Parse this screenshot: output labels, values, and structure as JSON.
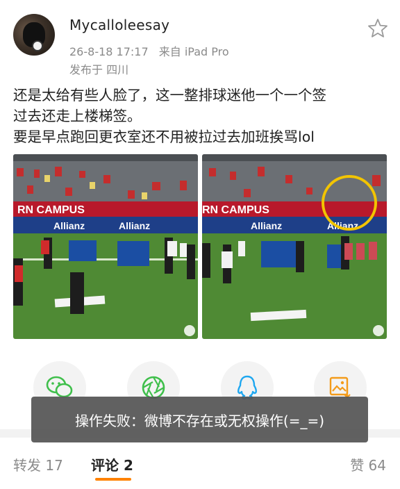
{
  "post": {
    "username": "Mycalloleesay",
    "timestamp": "26-8-18 17:17",
    "source": "来自 iPad Pro",
    "location": "发布于 四川",
    "text_line1": "还是太给有些人脸了，这一整排球迷他一个一个签",
    "text_line2": "过去还走上楼梯签。",
    "text_line3": "要是早点跑回更衣室还不用被拉过去加班挨骂lol"
  },
  "media": [
    {
      "banner_text": "RN CAMPUS",
      "sponsor": "Allianz"
    },
    {
      "banner_text": "RN CAMPUS",
      "sponsor": "Allianz"
    }
  ],
  "share": [
    {
      "icon": "wechat-icon",
      "color": "#3fbf4b"
    },
    {
      "icon": "moments-icon",
      "color": "#3fbf4b"
    },
    {
      "icon": "qq-icon",
      "color": "#1ea7f0"
    },
    {
      "icon": "save-image-icon",
      "color": "#f39b1a"
    }
  ],
  "toast": {
    "message": "操作失败：微博不存在或无权操作(=_=)"
  },
  "tabs": {
    "repost": "转发 17",
    "comment": "评论 2",
    "like": "赞 64"
  },
  "colors": {
    "accent": "#ff8200",
    "meta_gray": "#8a8a8a",
    "toast_bg": "#555555"
  }
}
